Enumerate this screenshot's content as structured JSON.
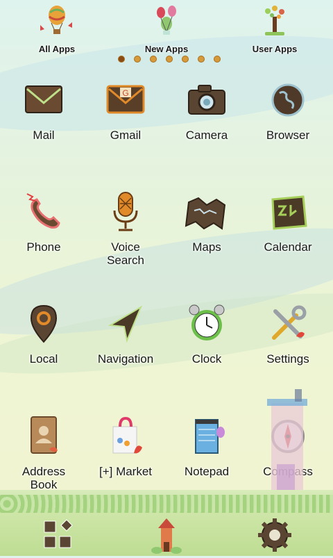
{
  "top_bar": {
    "items": [
      {
        "label": "All Apps",
        "icon": "balloon-basket-icon"
      },
      {
        "label": "New Apps",
        "icon": "balloons-icon"
      },
      {
        "label": "User Apps",
        "icon": "tree-icon"
      }
    ]
  },
  "page_indicator": {
    "count": 7,
    "active_index": 0
  },
  "apps": [
    {
      "label": "Mail",
      "icon": "mail-icon"
    },
    {
      "label": "Gmail",
      "icon": "gmail-icon",
      "glyph": "G"
    },
    {
      "label": "Camera",
      "icon": "camera-icon"
    },
    {
      "label": "Browser",
      "icon": "globe-icon"
    },
    {
      "label": "Phone",
      "icon": "phone-icon"
    },
    {
      "label": "Voice\nSearch",
      "icon": "microphone-icon"
    },
    {
      "label": "Maps",
      "icon": "map-icon"
    },
    {
      "label": "Calendar",
      "icon": "calendar-icon"
    },
    {
      "label": "Local",
      "icon": "location-pin-icon"
    },
    {
      "label": "Navigation",
      "icon": "navigation-arrow-icon"
    },
    {
      "label": "Clock",
      "icon": "alarm-clock-icon"
    },
    {
      "label": "Settings",
      "icon": "tools-icon"
    },
    {
      "label": "Address\nBook",
      "icon": "address-book-icon"
    },
    {
      "label": "[+] Market",
      "icon": "shopping-bag-icon"
    },
    {
      "label": "Notepad",
      "icon": "notepad-icon"
    },
    {
      "label": "Compass",
      "icon": "compass-icon"
    }
  ],
  "dock": {
    "items": [
      {
        "icon": "app-grid-icon"
      },
      {
        "icon": "house-home-icon"
      },
      {
        "icon": "gear-icon"
      }
    ]
  },
  "colors": {
    "label": "#1a1a1a",
    "accent": "#d69a3a",
    "dot_active": "#8a4b12"
  }
}
